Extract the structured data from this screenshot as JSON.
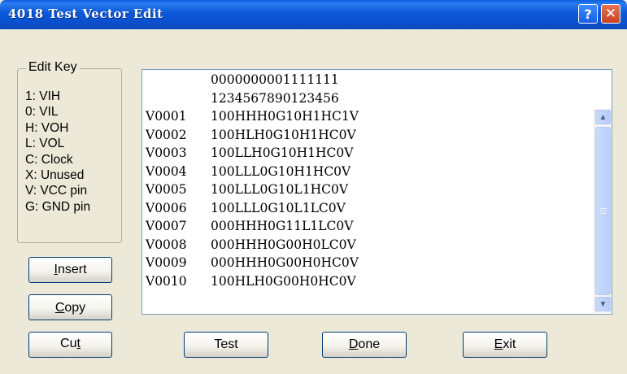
{
  "window": {
    "title": "4018 Test Vector Edit",
    "help_icon_glyph": "?",
    "close_icon_glyph": "✕"
  },
  "edit_key": {
    "legend": "Edit Key",
    "items": [
      "1: VIH",
      "0: VIL",
      "H: VOH",
      "L: VOL",
      "C: Clock",
      "X: Unused",
      "V: VCC pin",
      "G: GND pin"
    ]
  },
  "buttons": {
    "insert": {
      "pre": "",
      "mnemonic": "I",
      "post": "nsert"
    },
    "copy": {
      "pre": "",
      "mnemonic": "C",
      "post": "opy"
    },
    "cut": {
      "pre": "Cu",
      "mnemonic": "t",
      "post": ""
    },
    "test": {
      "pre": "Test",
      "mnemonic": "",
      "post": ""
    },
    "done": {
      "pre": "",
      "mnemonic": "D",
      "post": "one"
    },
    "exit": {
      "pre": "",
      "mnemonic": "E",
      "post": "xit"
    }
  },
  "vector_list": {
    "header_row1": "0000000001111111",
    "header_row2": "1234567890123456",
    "rows": [
      {
        "id": "V0001",
        "vector": "100HHH0G10H1HC1V"
      },
      {
        "id": "V0002",
        "vector": "100HLH0G10H1HC0V"
      },
      {
        "id": "V0003",
        "vector": "100LLH0G10H1HC0V"
      },
      {
        "id": "V0004",
        "vector": "100LLL0G10H1HC0V"
      },
      {
        "id": "V0005",
        "vector": "100LLL0G10L1HC0V"
      },
      {
        "id": "V0006",
        "vector": "100LLL0G10L1LC0V"
      },
      {
        "id": "V0007",
        "vector": "000HHH0G11L1LC0V"
      },
      {
        "id": "V0008",
        "vector": "000HHH0G00H0LC0V"
      },
      {
        "id": "V0009",
        "vector": "000HHH0G00H0HC0V"
      },
      {
        "id": "V0010",
        "vector": "100HLH0G00H0HC0V"
      }
    ]
  },
  "icons": {
    "help": "help-icon",
    "close": "close-icon",
    "scroll_up": "chevron-up-icon",
    "scroll_down": "chevron-down-icon"
  },
  "colors": {
    "titlebar": "#0a4fcc",
    "dialog_bg": "#ece9d8",
    "close_button": "#c8401e"
  }
}
